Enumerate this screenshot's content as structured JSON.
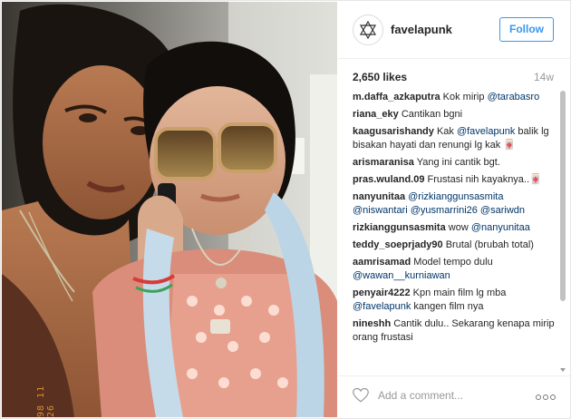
{
  "post": {
    "username": "favelapunk",
    "follow_label": "Follow",
    "likes": "2,650 likes",
    "age": "14w",
    "photo_timestamp": "98 11 26",
    "add_comment_placeholder": "Add a comment...",
    "brand_color": "#3897f0",
    "icons": {
      "avatar": "star-of-david-logo",
      "heart": "heart-icon",
      "more": "ellipsis-icon"
    }
  },
  "comments": [
    {
      "user": "m.daffa_azkaputra",
      "text": "Kok mirip ",
      "mention": "@tarabasro"
    },
    {
      "user": "riana_eky",
      "text": "Cantikan bgni",
      "mention": ""
    },
    {
      "user": "kaagusarishandy",
      "text": "Kak ",
      "mention": "@favelapunk",
      "after": " balik lg bisakan hayati dan renungi lg kak 🀄"
    },
    {
      "user": "arismaranisa",
      "text": "Yang ini cantik bgt.",
      "mention": ""
    },
    {
      "user": "pras.wuland.09",
      "text": "Frustasi nih kayaknya..🀄",
      "mention": ""
    },
    {
      "user": "nanyunitaa",
      "text": "",
      "mention": "@rizkianggunsasmita @niswantari @yusmarrini26 @sariwdn"
    },
    {
      "user": "rizkianggunsasmita",
      "text": "wow ",
      "mention": "@nanyunitaa"
    },
    {
      "user": "teddy_soeprjady90",
      "text": "Brutal (brubah total)",
      "mention": ""
    },
    {
      "user": "aamrisamad",
      "text": "Model tempo dulu ",
      "mention": "@wawan__kurniawan"
    },
    {
      "user": "penyair4222",
      "text": "Kpn main film lg mba ",
      "mention": "@favelapunk",
      "after": " kangen film nya"
    },
    {
      "user": "nineshh",
      "text": "Cantik dulu.. Sekarang kenapa mirip orang frustasi",
      "mention": ""
    }
  ]
}
